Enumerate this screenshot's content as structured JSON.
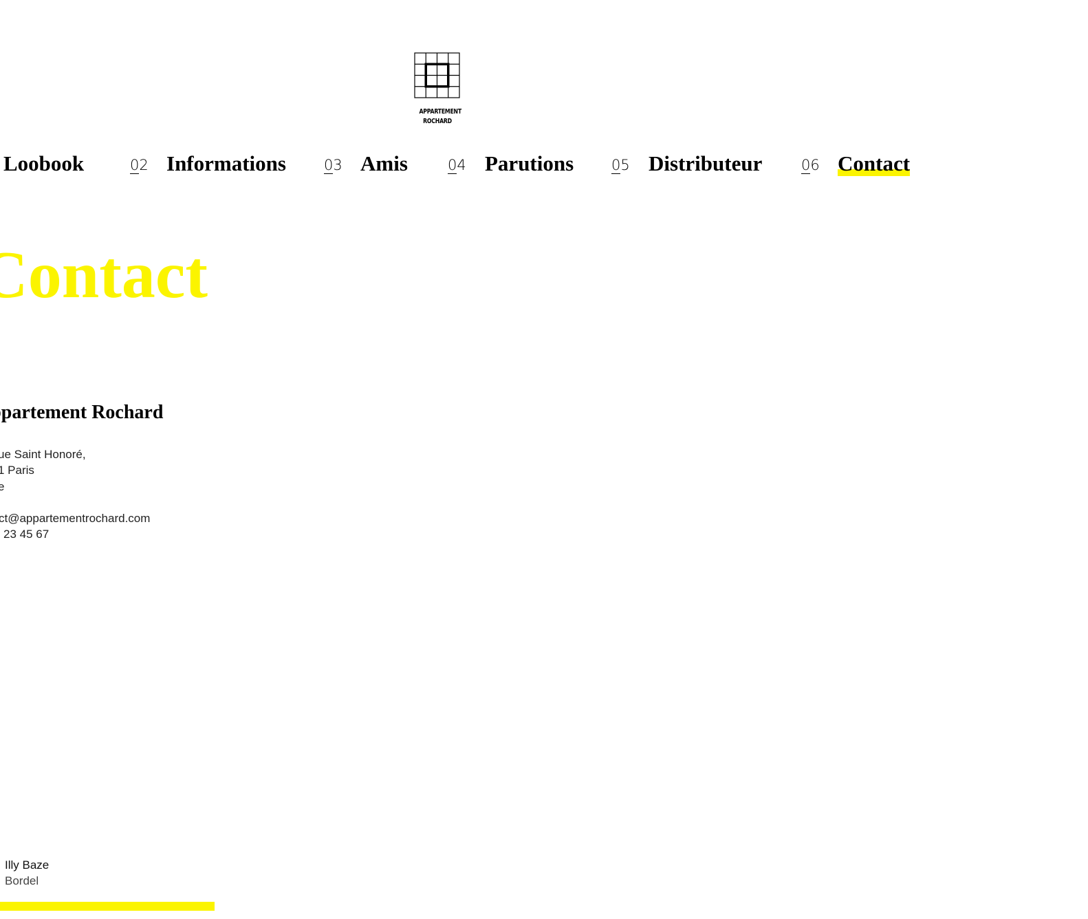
{
  "brand": {
    "logo_line1": "APPARTEMENT",
    "logo_line2": "ROCHARD"
  },
  "nav": {
    "items": [
      {
        "number": "",
        "label": "Loobook"
      },
      {
        "number": "02",
        "label": "Informations"
      },
      {
        "number": "03",
        "label": "Amis"
      },
      {
        "number": "04",
        "label": "Parutions"
      },
      {
        "number": "05",
        "label": "Distributeur"
      },
      {
        "number": "06",
        "label": "Contact",
        "active": true
      }
    ]
  },
  "page": {
    "title": "Contact"
  },
  "contact": {
    "company": "Appartement Rochard",
    "address_line1": "ue Saint Honoré,",
    "address_line2": "1 Paris",
    "address_line3": "e",
    "email": "ct@appartementrochard.com",
    "phone": "23 45 67"
  },
  "credits": {
    "line1": "Illy Baze",
    "line2": "Bordel"
  },
  "colors": {
    "accent": "#fbf400",
    "text": "#000000",
    "background": "#ffffff"
  }
}
